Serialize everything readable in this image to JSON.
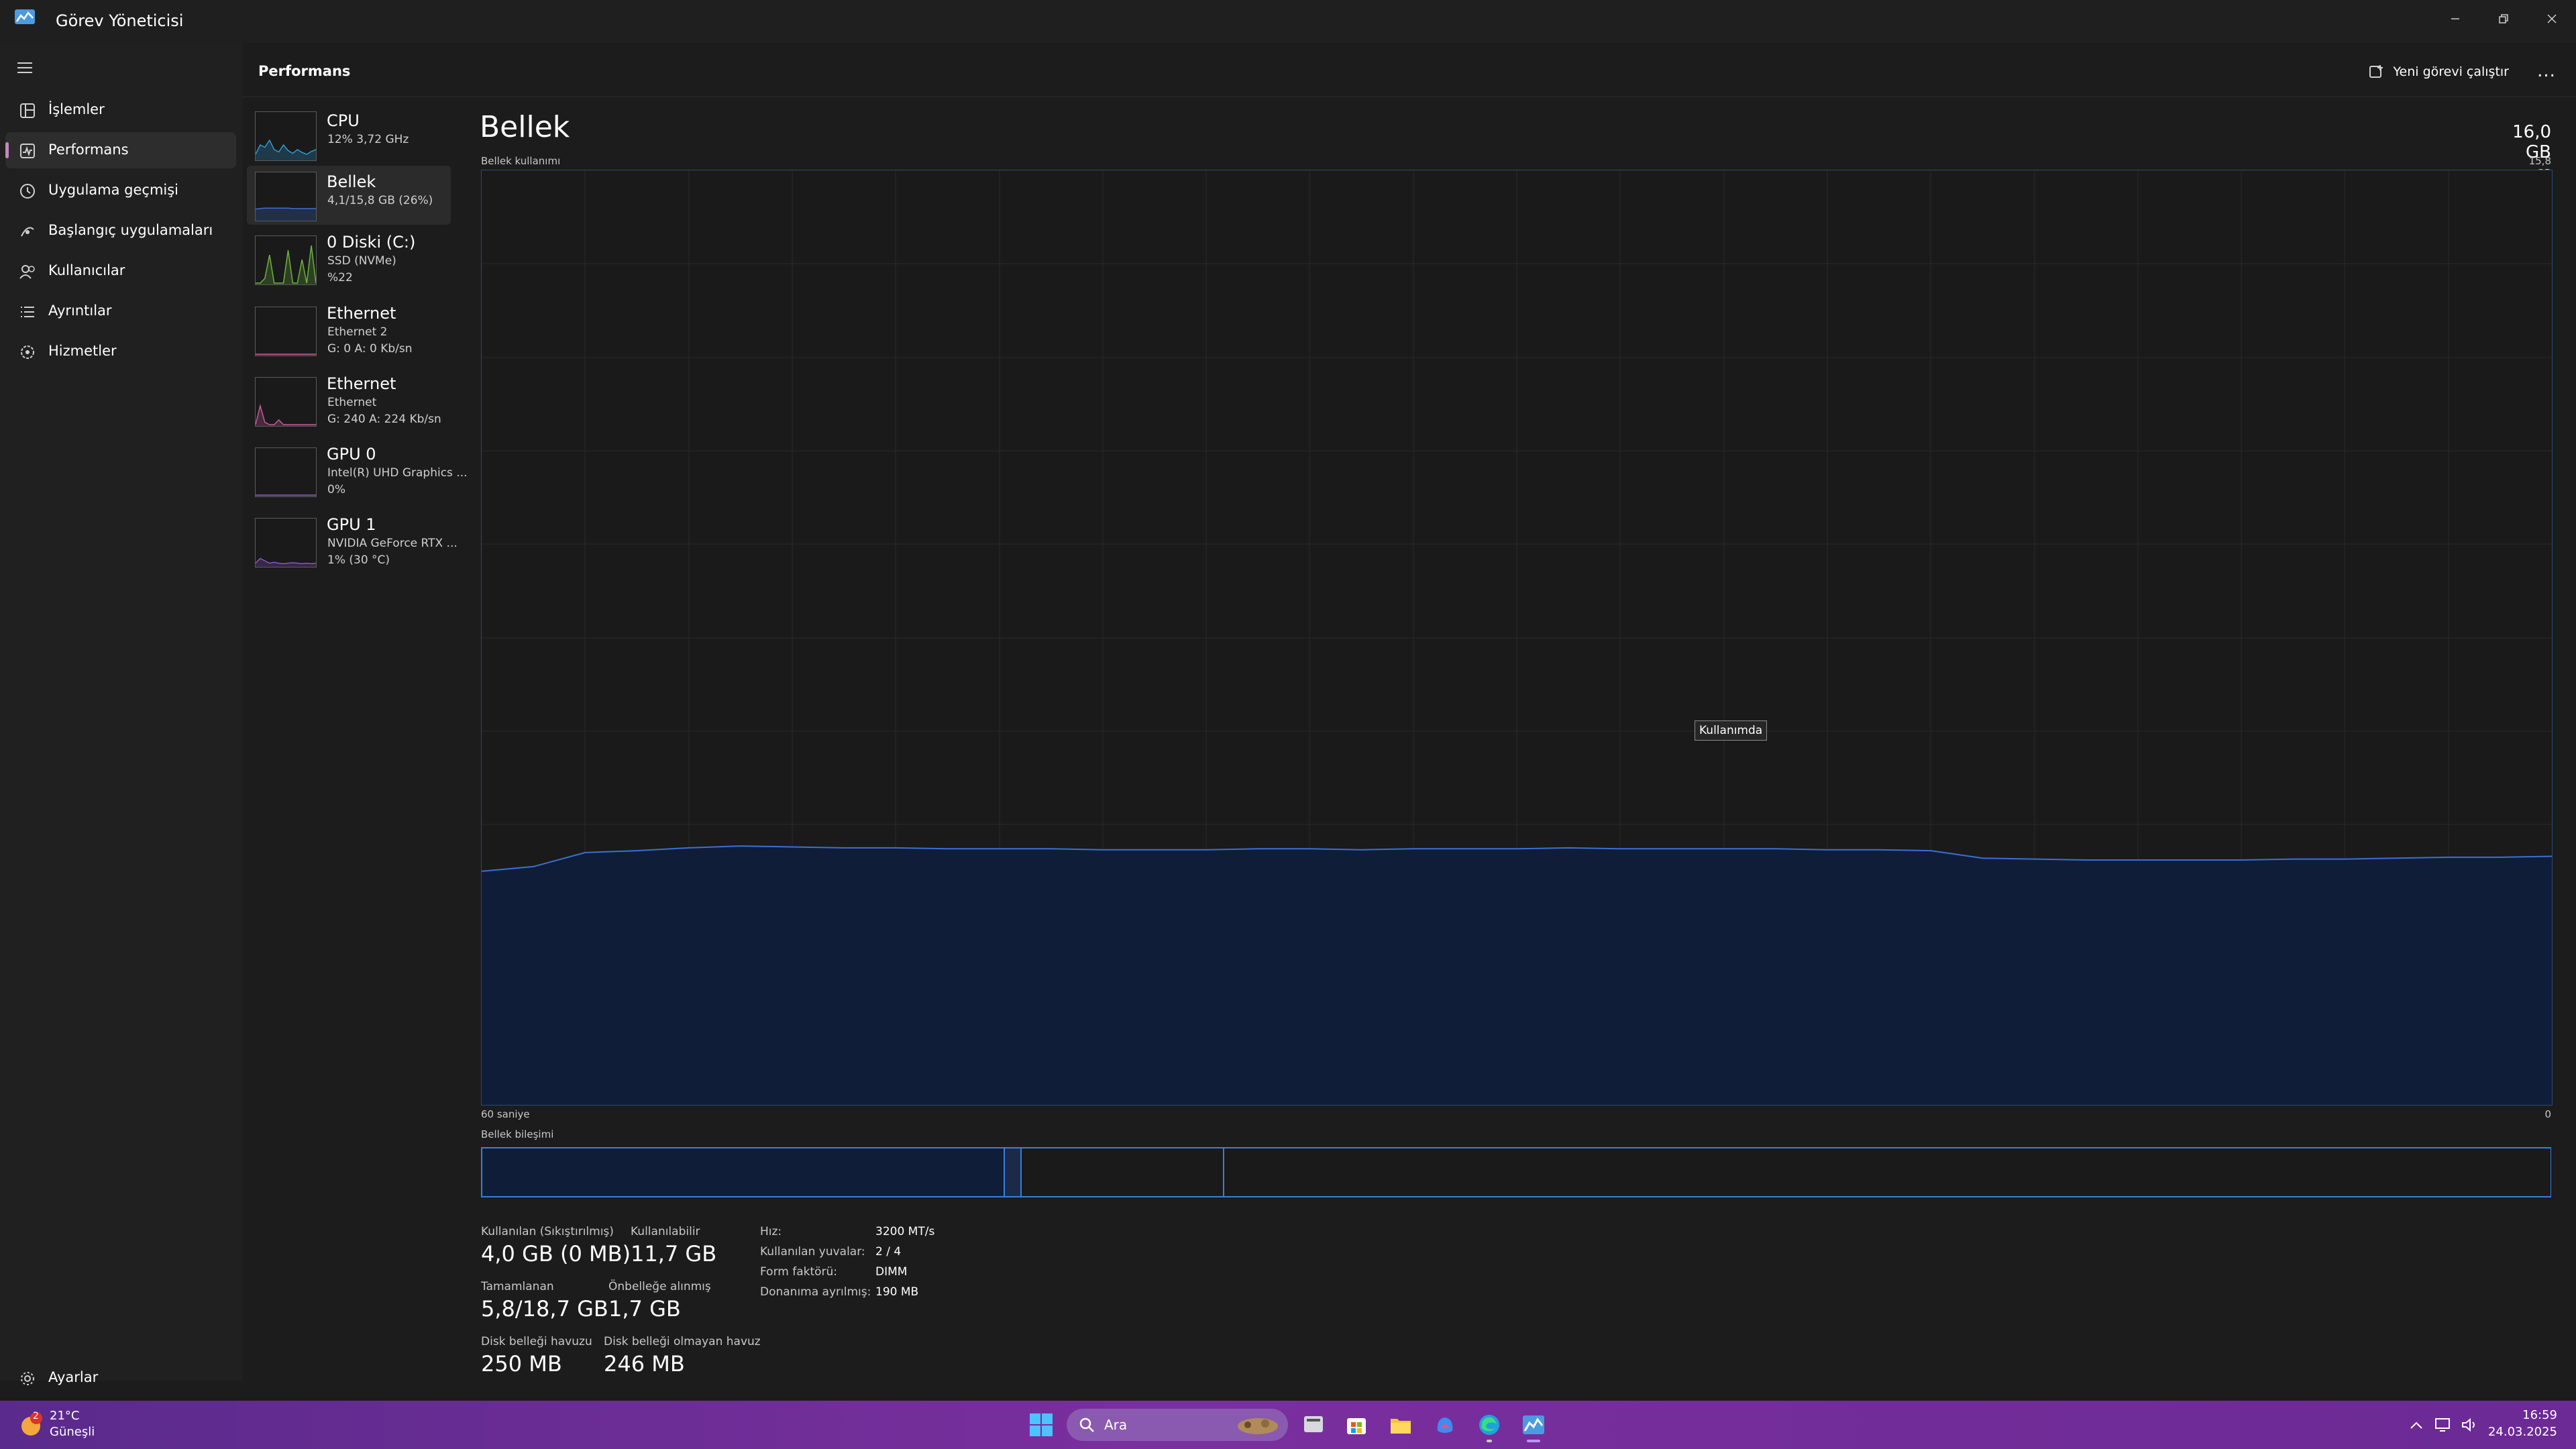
{
  "window": {
    "title": "Görev Yöneticisi"
  },
  "nav": {
    "items": [
      {
        "label": "İşlemler",
        "icon": "processes-icon"
      },
      {
        "label": "Performans",
        "icon": "performance-icon"
      },
      {
        "label": "Uygulama geçmişi",
        "icon": "history-icon"
      },
      {
        "label": "Başlangıç uygulamaları",
        "icon": "startup-icon"
      },
      {
        "label": "Kullanıcılar",
        "icon": "users-icon"
      },
      {
        "label": "Ayrıntılar",
        "icon": "details-icon"
      },
      {
        "label": "Hizmetler",
        "icon": "services-icon"
      }
    ],
    "settings_label": "Ayarlar",
    "active": "Performans"
  },
  "header": {
    "title": "Performans",
    "new_task_label": "Yeni görevi çalıştır",
    "more_label": "..."
  },
  "devices": [
    {
      "name": "CPU",
      "lines": [
        "12% 3,72 GHz"
      ],
      "color": "#2f9ad6"
    },
    {
      "name": "Bellek",
      "lines": [
        "4,1/15,8 GB (26%)"
      ],
      "color": "#3a6fd8"
    },
    {
      "name": "0 Diski (C:)",
      "lines": [
        "SSD (NVMe)",
        "%22"
      ],
      "color": "#6db33f"
    },
    {
      "name": "Ethernet",
      "lines": [
        "Ethernet 2",
        "G: 0 A: 0 Kb/sn"
      ],
      "color": "#c75a9b"
    },
    {
      "name": "Ethernet",
      "lines": [
        "Ethernet",
        "G: 240 A: 224 Kb/sn"
      ],
      "color": "#c75a9b"
    },
    {
      "name": "GPU 0",
      "lines": [
        "Intel(R) UHD Graphics ...",
        "0%"
      ],
      "color": "#8c55c7"
    },
    {
      "name": "GPU 1",
      "lines": [
        "NVIDIA GeForce RTX ...",
        "1% (30 °C)"
      ],
      "color": "#8c55c7"
    }
  ],
  "memory": {
    "title": "Bellek",
    "total": "16,0 GB",
    "usage_label": "Bellek kullanımı",
    "usage_max": "15,8 GB",
    "time_left": "60 saniye",
    "time_right": "0",
    "tooltip": "Kullanımda",
    "composition_label": "Bellek bileşimi",
    "graph_usage_fraction": [
      0.25,
      0.255,
      0.27,
      0.272,
      0.275,
      0.277,
      0.276,
      0.275,
      0.275,
      0.274,
      0.274,
      0.274,
      0.273,
      0.273,
      0.273,
      0.274,
      0.274,
      0.273,
      0.274,
      0.274,
      0.274,
      0.275,
      0.274,
      0.274,
      0.274,
      0.274,
      0.273,
      0.273,
      0.272,
      0.264,
      0.263,
      0.262,
      0.262,
      0.262,
      0.262,
      0.263,
      0.263,
      0.264,
      0.265,
      0.265,
      0.266
    ],
    "composition_fraction": {
      "in_use": 0.252,
      "modified": 0.008,
      "standby": 0.098,
      "free": 0.642
    },
    "stats": [
      {
        "label": "Kullanılan (Sıkıştırılmış)",
        "value": "4,0 GB (0 MB)"
      },
      {
        "label": "Kullanılabilir",
        "value": "11,7 GB"
      },
      {
        "label": "Tamamlanan",
        "value": "5,8/18,7 GB"
      },
      {
        "label": "Önbelleğe alınmış",
        "value": "1,7 GB"
      },
      {
        "label": "Disk belleği havuzu",
        "value": "250 MB"
      },
      {
        "label": "Disk belleği olmayan havuz",
        "value": "246 MB"
      }
    ],
    "details": [
      {
        "key": "Hız:",
        "value": "3200 MT/s"
      },
      {
        "key": "Kullanılan yuvalar:",
        "value": "2 / 4"
      },
      {
        "key": "Form faktörü:",
        "value": "DIMM"
      },
      {
        "key": "Donanıma ayrılmış:",
        "value": "190 MB"
      }
    ]
  },
  "taskbar": {
    "weather_temp": "21°C",
    "weather_desc": "Güneşli",
    "weather_badge": "2",
    "search_placeholder": "Ara",
    "time": "16:59",
    "date": "24.03.2025"
  },
  "colors": {
    "memory_fill": "#0f1d38",
    "memory_line": "#3a6fd8",
    "accent_bar": "#c586c0"
  }
}
